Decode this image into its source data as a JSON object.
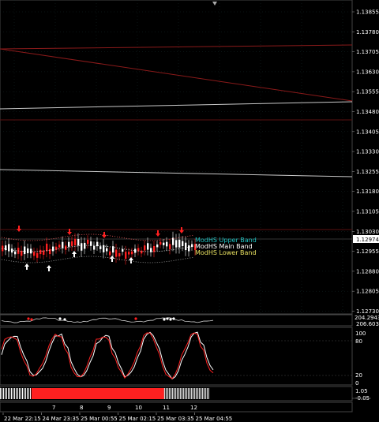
{
  "colors": {
    "background": "#000000",
    "grid": "#1a3a3a",
    "trendline_red": "#8b1a1a",
    "trendline_white": "#c8c8c8",
    "bull": "#ffffff",
    "bear": "#ff2020",
    "upper_band": "#20c0c0",
    "main_band": "#ffffff",
    "lower_band": "#e8e060",
    "price_tag_bg": "#ffffff",
    "price_tag_fg": "#000000"
  },
  "main_chart": {
    "price_axis": [
      "1.13855",
      "1.13780",
      "1.13705",
      "1.13630",
      "1.13555",
      "1.13480",
      "1.13405",
      "1.13330",
      "1.13255",
      "1.13180",
      "1.13105",
      "1.13030",
      "1.12955",
      "1.12880",
      "1.12805",
      "1.12730"
    ],
    "current_price": "1.12974",
    "band_labels": {
      "upper": "ModHS Upper Band",
      "main": "ModHS Main Band",
      "lower": "ModHS Lower Band"
    }
  },
  "cci_panel": {
    "top_value": "204.2943",
    "second_value": "206.6036"
  },
  "stoch_panel": {
    "levels": [
      "100",
      "80",
      "20",
      "0"
    ]
  },
  "bar_panel": {
    "levels": [
      "1.05",
      "-0.05"
    ],
    "segments": [
      {
        "state": "bull",
        "fraction": 0.083
      },
      {
        "state": "bear",
        "fraction": 0.35
      },
      {
        "state": "bull",
        "fraction": 0.12
      }
    ]
  },
  "top_marker": "arrow-down-icon",
  "time_axis": {
    "labels": [
      "22 Mar 22:15",
      "24 Mar 23:35",
      "25 Mar 00:55",
      "25 Mar 02:15",
      "25 Mar 03:35",
      "25 Mar 04:55"
    ],
    "day_numbers": [
      "7",
      "8",
      "9",
      "10",
      "11",
      "12"
    ]
  }
}
